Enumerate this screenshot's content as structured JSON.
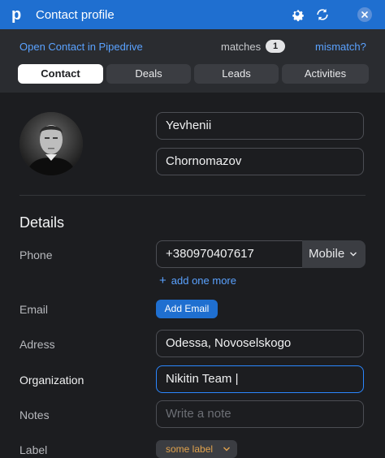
{
  "header": {
    "title": "Contact profile",
    "logo_letter": "p",
    "accent": "#1f6fd0"
  },
  "subbar": {
    "open_link": "Open Contact in Pipedrive",
    "matches_label": "matches",
    "matches_count": "1",
    "mismatch_link": "mismatch?"
  },
  "tabs": [
    {
      "label": "Contact",
      "active": true
    },
    {
      "label": "Deals",
      "active": false
    },
    {
      "label": "Leads",
      "active": false
    },
    {
      "label": "Activities",
      "active": false
    }
  ],
  "contact": {
    "first_name": "Yevhenii",
    "last_name": "Chornomazov"
  },
  "details": {
    "title": "Details",
    "phone_label": "Phone",
    "phone_value": "+380970407617",
    "phone_type": "Mobile",
    "add_one_more": "add one more",
    "email_label": "Email",
    "add_email_button": "Add Email",
    "address_label": "Adress",
    "address_value": "Odessa, Novoselskogo",
    "organization_label": "Organization",
    "organization_value": "Nikitin Team |",
    "notes_label": "Notes",
    "notes_placeholder": "Write a note",
    "label_label": "Label",
    "label_value": "some label"
  }
}
